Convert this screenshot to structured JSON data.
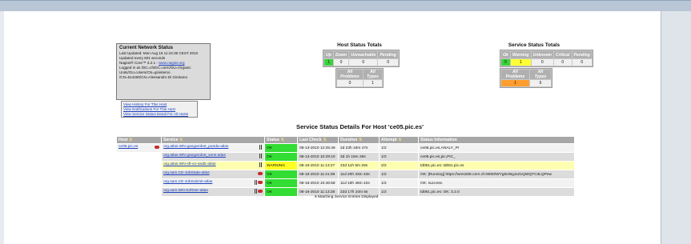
{
  "status": {
    "title": "Current Network Status",
    "updated": "Last Updated: Mon Aug 16 11:44:36 CEST 2010",
    "interval": "Updated every 601 seconds",
    "version_prefix": "Nagios® Core™ 3.2.1 - ",
    "version_link": "www.nagios.org",
    "logged_in": "Logged in as /DC=ch/DC=cern/OU=Organic Units/OU=Users/CN=ginistemo /CN=614260/CN=Alessandro Di Girolamo"
  },
  "links": [
    "View History For This Host",
    "View Notifications For This Host",
    "View Service Status Detail For All Hosts"
  ],
  "host_totals": {
    "title": "Host Status Totals",
    "headers": [
      "Up",
      "Down",
      "Unreachable",
      "Pending"
    ],
    "values": [
      "1",
      "0",
      "0",
      "0"
    ],
    "summary_headers": [
      "All Problems",
      "All Types"
    ],
    "summary_values": [
      "0",
      "1"
    ]
  },
  "service_totals": {
    "title": "Service Status Totals",
    "headers": [
      "Ok",
      "Warning",
      "Unknown",
      "Critical",
      "Pending"
    ],
    "values": [
      "5",
      "1",
      "0",
      "0",
      "0"
    ],
    "summary_headers": [
      "All Problems",
      "All Types"
    ],
    "summary_values": [
      "1",
      "6"
    ]
  },
  "page_title": "Service Status Details For Host 'ce05.pic.es'",
  "table": {
    "headers": [
      "Host",
      "Service",
      "Status",
      "Last Check",
      "Duration",
      "Attempt",
      "Status Information"
    ],
    "rows": [
      {
        "host": "ce05.pic.es",
        "service": "org.atlas.WN-gangarobot_panda-atlas",
        "status": "OK",
        "last_check": "08-13-2010 12:25:49",
        "duration": "2d 23h 18m 47s",
        "attempt": "1/2",
        "info": "ce05.pic.es,ANALY_PI"
      },
      {
        "host": "",
        "service": "org.atlas.WN-gangarobot_wms-atlas",
        "status": "OK",
        "last_check": "08-13-2010 10:29:10",
        "duration": "3d 1h 15m 26s",
        "attempt": "1/2",
        "info": "ce05.pic.es,pic,PIC_"
      },
      {
        "host": "",
        "service": "org.atlas.WN-sft-vo-swdir-atlas",
        "status": "WARNING",
        "last_check": "08-16-2010 11:13:27",
        "duration": "22d 11h 9m 28s",
        "attempt": "2/2",
        "info": "td061.pic.es: td061.pic.es"
      },
      {
        "host": "",
        "service": "org.sam.CE-JobState-atlas",
        "status": "OK",
        "last_check": "08-16-2010 11:41:08",
        "duration": "11d 20h 33m 43s",
        "attempt": "1/2",
        "info": "OK: [Running] https://wms208.cern.ch:9000/WYg0vWgJxZ1QWQTC3LQPew"
      },
      {
        "host": "",
        "service": "org.sam.CE-JobSubmit-atlas",
        "status": "OK",
        "last_check": "08-16-2010 10:46:58",
        "duration": "11d 19h 48m 42s",
        "attempt": "1/2",
        "info": "OK: success."
      },
      {
        "host": "",
        "service": "org.sam.WN-SoftVer-atlas",
        "status": "OK",
        "last_check": "08-16-2010 11:13:28",
        "duration": "22d 17h 10m 5s",
        "attempt": "1/2",
        "info": "td061.pic.es: OK: 3.2.0"
      }
    ]
  },
  "footer": "6 Matching Service Entries Displayed",
  "colors": {
    "ok": "#33dd33",
    "warning": "#ffff22",
    "problems": "#ff9d2e"
  }
}
